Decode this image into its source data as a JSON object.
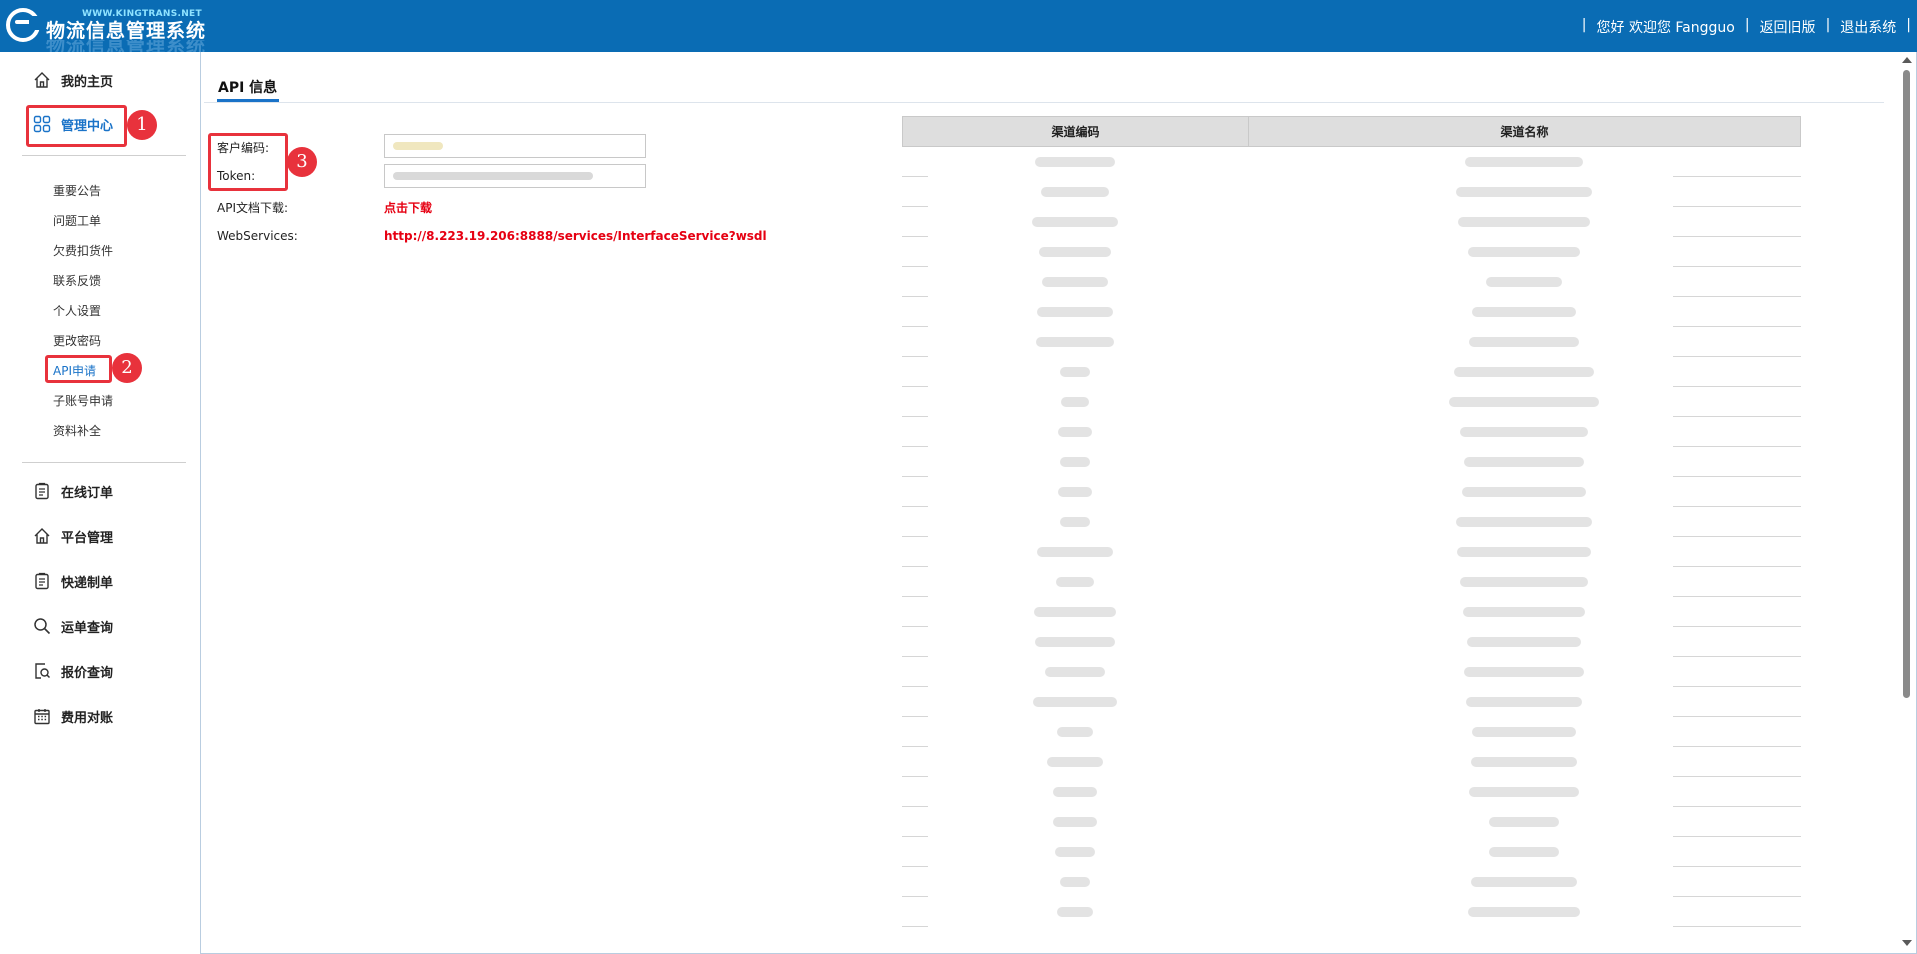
{
  "header": {
    "logo_url": "WWW.KINGTRANS.NET",
    "logo_title": "物流信息管理系统",
    "greeting": "您好 欢迎您 Fangguo",
    "back_old": "返回旧版",
    "logout": "退出系统",
    "brand_color": "#0a6cb4"
  },
  "sidebar": {
    "top_items": [
      {
        "label": "我的主页",
        "icon": "home-icon"
      },
      {
        "label": "管理中心",
        "icon": "grid-icon"
      }
    ],
    "sub_items": [
      {
        "label": "重要公告"
      },
      {
        "label": "问题工单"
      },
      {
        "label": "欠费扣货件"
      },
      {
        "label": "联系反馈"
      },
      {
        "label": "个人设置"
      },
      {
        "label": "更改密码"
      },
      {
        "label": "API申请"
      },
      {
        "label": "子账号申请"
      },
      {
        "label": "资料补全"
      }
    ],
    "bottom_items": [
      {
        "label": "在线订单",
        "icon": "clipboard-icon"
      },
      {
        "label": "平台管理",
        "icon": "home-icon"
      },
      {
        "label": "快递制单",
        "icon": "clipboard-icon"
      },
      {
        "label": "运单查询",
        "icon": "search-icon"
      },
      {
        "label": "报价查询",
        "icon": "document-search-icon"
      },
      {
        "label": "费用对账",
        "icon": "calendar-icon"
      }
    ],
    "accent_color": "#1a73c8"
  },
  "callouts": [
    "1",
    "2",
    "3"
  ],
  "main": {
    "tab_label": "API 信息",
    "fields": {
      "customer_code_label": "客户编码:",
      "token_label": "Token:",
      "doc_label": "API文档下载:",
      "doc_link": "点击下载",
      "ws_label": "WebServices:",
      "ws_url": "http://8.223.19.206:8888/services/InterfaceService?wsdl"
    }
  },
  "table": {
    "columns": [
      "渠道编码",
      "渠道名称"
    ]
  }
}
